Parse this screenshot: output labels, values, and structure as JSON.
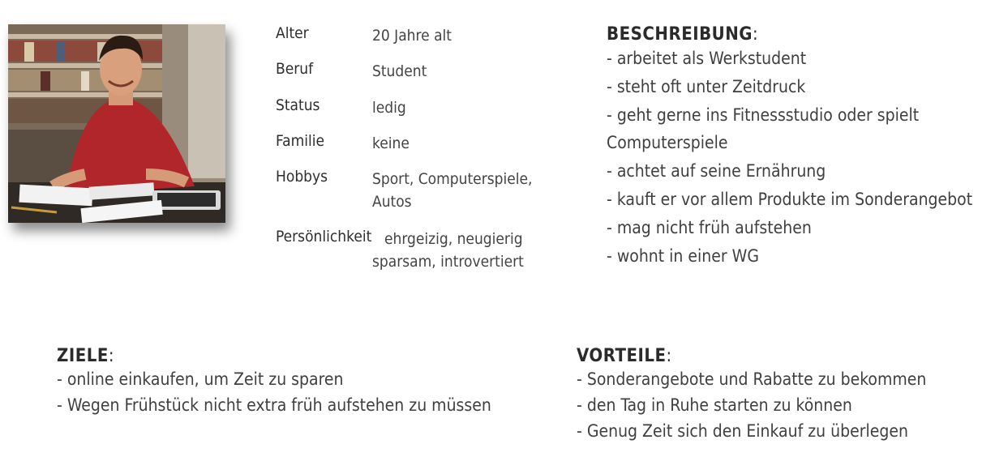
{
  "profile": {
    "rows": [
      {
        "label": "Alter",
        "value": [
          "20 Jahre alt"
        ]
      },
      {
        "label": "Beruf",
        "value": [
          "Student"
        ]
      },
      {
        "label": "Status",
        "value": [
          "ledig"
        ]
      },
      {
        "label": "Familie",
        "value": [
          "keine"
        ]
      },
      {
        "label": "Hobbys",
        "value": [
          "Sport, Computerspiele,",
          "Autos"
        ]
      },
      {
        "label": "Persönlichkeit",
        "value": [
          "ehrgeizig, neugierig",
          "sparsam, introvertiert"
        ]
      }
    ]
  },
  "beschreibung": {
    "heading": "BESCHREIBUNG",
    "colon": ":",
    "items": [
      "- arbeitet als Werkstudent",
      "- steht oft unter Zeitdruck",
      "- geht gerne ins Fitnessstudio oder spielt",
      "Computerspiele",
      "- achtet auf seine Ernährung",
      "- kauft er vor allem Produkte im Sonderangebot",
      "- mag nicht früh aufstehen",
      "- wohnt in einer WG"
    ]
  },
  "ziele": {
    "heading": "ZIELE",
    "colon": ":",
    "items": [
      "- online einkaufen, um Zeit zu sparen",
      "- Wegen Frühstück nicht extra früh aufstehen zu müssen"
    ]
  },
  "vorteile": {
    "heading": "VORTEILE",
    "colon": ":",
    "items": [
      "- Sonderangebote und Rabatte zu bekommen",
      "- den Tag in Ruhe starten zu können",
      "- Genug Zeit sich den Einkauf zu überlegen"
    ]
  }
}
